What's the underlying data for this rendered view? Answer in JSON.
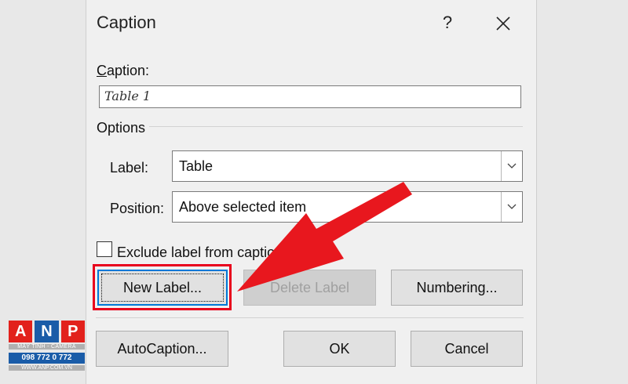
{
  "dialog": {
    "title": "Caption",
    "help_label": "?",
    "caption_label": "Caption:",
    "caption_label_rest": "aption:",
    "caption_value": "Table 1",
    "options_heading": "Options",
    "label_field": {
      "label": "Label:",
      "value": "Table"
    },
    "position_field": {
      "label": "Position:",
      "value": "Above selected item"
    },
    "exclude_label": "Exclude label from caption",
    "buttons": {
      "new_label": "New Label...",
      "delete_label": "Delete Label",
      "numbering": "Numbering...",
      "autocaption": "AutoCaption...",
      "ok": "OK",
      "cancel": "Cancel"
    }
  },
  "annotation": {
    "highlight_color": "#e8001c",
    "target": "new-label-button"
  },
  "watermark": {
    "letters": [
      "A",
      "N",
      "P"
    ],
    "tagline": "MÁY TÍNH - CAMERA",
    "phone": "098 772 0 772",
    "website": "WWW.ANP.COM.VN"
  }
}
